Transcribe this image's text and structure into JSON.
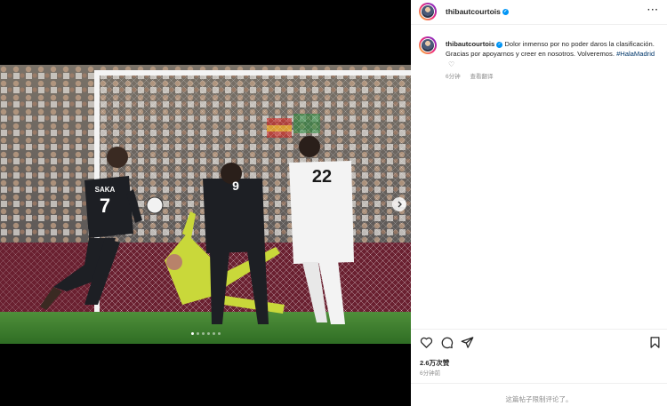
{
  "post": {
    "username": "thibautcourtois",
    "caption": "Dolor inmenso por no poder daros la clasificación. Gracias por apoyarnos y creer en nosotros. Volveremos.",
    "hashtag": "#HalaMadrid",
    "caption_time": "6分钟",
    "translate": "查看翻译",
    "likes": "2.6万次赞",
    "post_time": "6分钟前",
    "comments_closed": "这篇帖子限制评论了。"
  },
  "photo": {
    "player_left_name": "SAKA",
    "player_left_number": "7",
    "player_mid_number": "9",
    "player_right_number": "22",
    "carousel_dots": 6,
    "active_dot": 1
  },
  "icons": {
    "like": "heart-icon",
    "comment": "comment-icon",
    "share": "share-icon",
    "save": "bookmark-icon",
    "more": "more-icon",
    "next": "chevron-right-icon"
  },
  "colors": {
    "verified": "#0095f6",
    "link": "#00376b",
    "muted": "#8e8e8e"
  }
}
